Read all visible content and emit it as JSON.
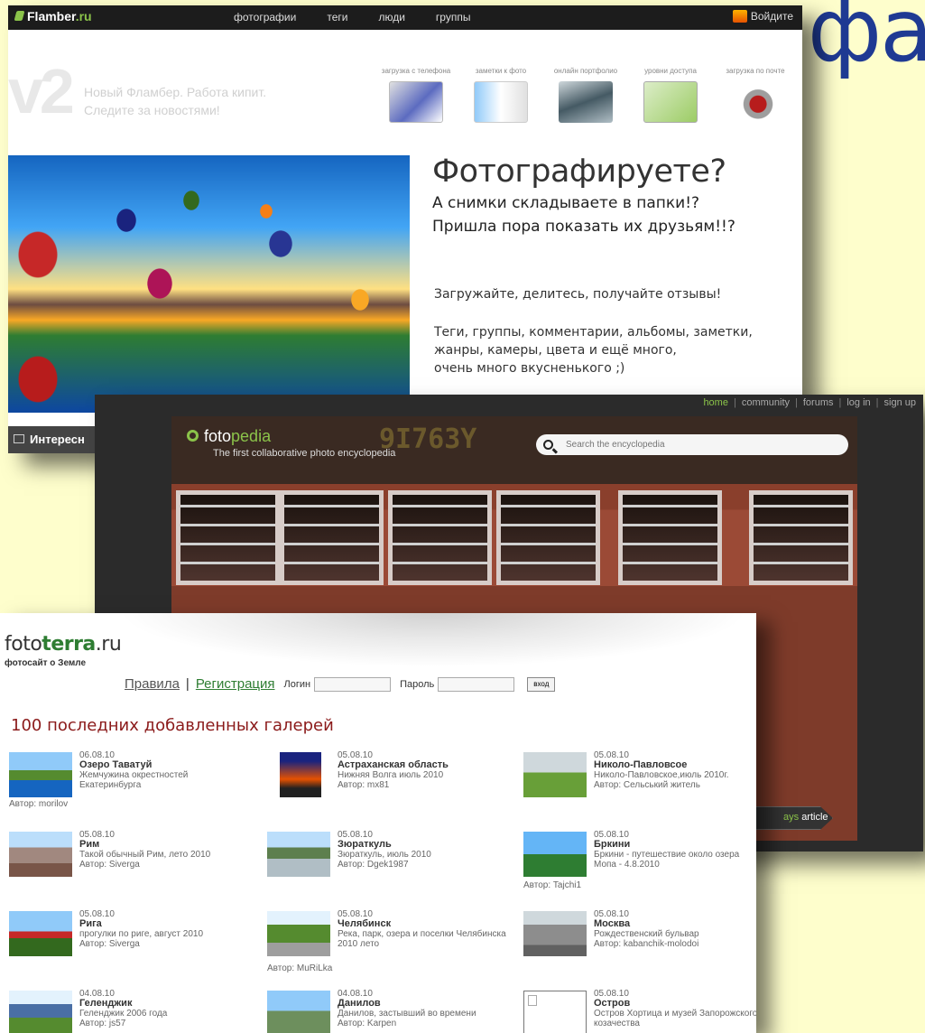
{
  "slide": {
    "title_fragment": "фа"
  },
  "flamber": {
    "logo": "Flamber",
    "logo_tld": ".ru",
    "nav": [
      "фотографии",
      "теги",
      "люди",
      "группы"
    ],
    "login": "Войдите",
    "v2": "v2",
    "news_line1": "Новый Фламбер. Работа кипит.",
    "news_line2": "Следите за новостями!",
    "features": [
      "загрузка с телефона",
      "заметки к фото",
      "онлайн портфолио",
      "уровни доступа",
      "загрузка по почте"
    ],
    "headline": "Фотографируете?",
    "sub1": "А снимки складываете в папки!?",
    "sub2": "Пришла пора показать их друзьям!!?",
    "p1": "Загружайте, делитесь, получайте отзывы!",
    "p2_line1": "Теги, группы, комментарии, альбомы, заметки,",
    "p2_line2": "жанры, камеры, цвета и ещё много,",
    "p2_line3": "очень много вкусненького ;)",
    "tab_label": "Интересн"
  },
  "fotopedia": {
    "nav": {
      "home": "home",
      "community": "community",
      "forums": "forums",
      "login": "log in",
      "signup": "sign up"
    },
    "logo_a": "foto",
    "logo_b": "pedia",
    "tagline": "The first collaborative photo encyclopedia",
    "ghost": "9I763Y",
    "search_placeholder": "Search the encyclopedia",
    "article_faded": "ays",
    "article": "article"
  },
  "fototerra": {
    "logo_a": "foto",
    "logo_b": "terra",
    "logo_c": ".ru",
    "subtitle": "фотосайт о Земле",
    "rules": "Правила",
    "separator": "|",
    "register": "Регистрация",
    "login_label": "Логин",
    "password_label": "Пароль",
    "enter_button": "вход",
    "heading": "100 последних добавленных галерей",
    "galleries": [
      {
        "date": "06.08.10",
        "name": "Озеро Таватуй",
        "desc": "Жемчужина окрестностей Екатеринбурга",
        "author": "Автор: morilov",
        "author_below": true
      },
      {
        "date": "05.08.10",
        "name": "Астраханская область",
        "desc": "Нижняя Волга июль 2010",
        "author": "Автор: mx81",
        "author_below": false
      },
      {
        "date": "05.08.10",
        "name": "Николо-Павловсое",
        "desc": "Николо-Павловское,июль 2010г.",
        "author": "Автор: Сельський житель",
        "author_below": false
      },
      {
        "date": "05.08.10",
        "name": "Рим",
        "desc": "Такой обычный Рим, лето 2010",
        "author": "Автор: Siverga",
        "author_below": false
      },
      {
        "date": "05.08.10",
        "name": "Зюраткуль",
        "desc": "Зюраткуль, июль 2010",
        "author": "Автор: Dgek1987",
        "author_below": false
      },
      {
        "date": "05.08.10",
        "name": "Бркини",
        "desc": "Бркини - путешествие около озера Мопа - 4.8.2010",
        "author": "Автор: Tajchi1",
        "author_below": true
      },
      {
        "date": "05.08.10",
        "name": "Рига",
        "desc": "прогулки по риге, август 2010",
        "author": "Автор: Siverga",
        "author_below": false
      },
      {
        "date": "05.08.10",
        "name": "Челябинск",
        "desc": "Река, парк, озера и поселки Челябинска 2010 лето",
        "author": "Автор: MuRiLka",
        "author_below": true
      },
      {
        "date": "05.08.10",
        "name": "Москва",
        "desc": "Рождественский бульвар",
        "author": "Автор: kabanchik-molodoi",
        "author_below": false
      },
      {
        "date": "04.08.10",
        "name": "Геленджик",
        "desc": "Геленджик 2006 года",
        "author": "Автор: js57",
        "author_below": false
      },
      {
        "date": "04.08.10",
        "name": "Данилов",
        "desc": "Данилов, застывший во времени",
        "author": "Автор: Karpen",
        "author_below": false
      },
      {
        "date": "05.08.10",
        "name": "Остров",
        "desc": "Остров Хортица и музей Запорожского козачества",
        "author": "",
        "author_below": false
      }
    ]
  }
}
